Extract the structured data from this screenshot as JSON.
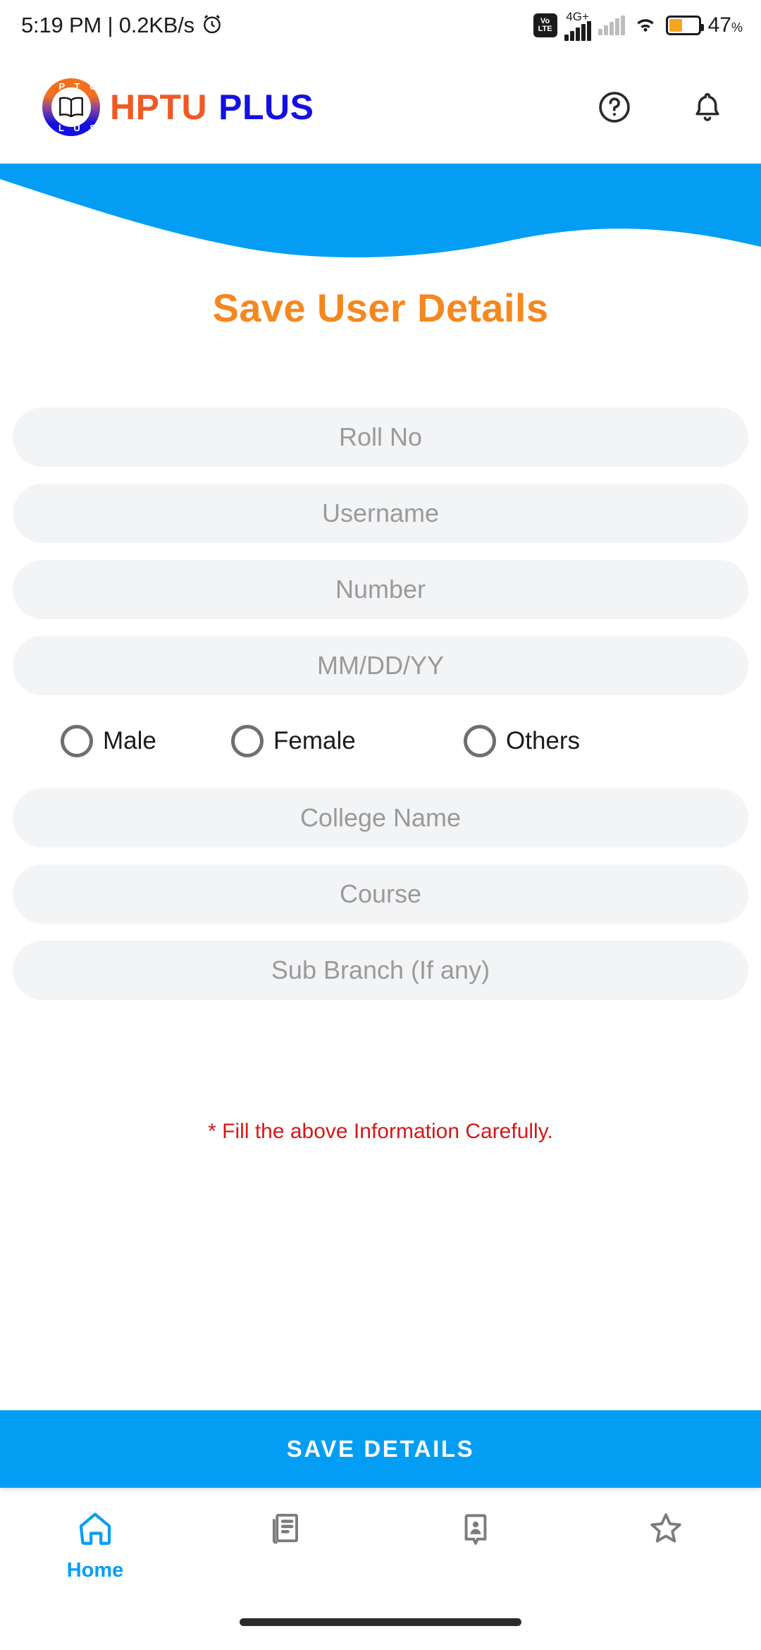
{
  "status_bar": {
    "time": "5:19 PM",
    "separator": "|",
    "data_rate": "0.2KB/s",
    "alarm_icon": "alarm-icon",
    "volte_top": "Vo",
    "volte_bottom": "LTE",
    "network_type": "4G+",
    "wifi_icon": "wifi-icon",
    "battery_percent": "47",
    "battery_unit": "%"
  },
  "header": {
    "logo_arc_top": "H P T U",
    "logo_arc_bottom": "P L U S",
    "brand_primary": "HPTU",
    "brand_secondary": "PLUS",
    "help_icon": "help-circle-icon",
    "bell_icon": "bell-icon"
  },
  "colors": {
    "accent_blue": "#039ef4",
    "brand_orange": "#ef5a24",
    "brand_blue": "#1510e0",
    "title_orange": "#f5871f",
    "warning_red": "#d61717",
    "field_bg": "#f3f4f6",
    "placeholder": "#9a9a9a"
  },
  "main": {
    "title": "Save User Details",
    "fields": [
      {
        "name": "roll-no",
        "placeholder": "Roll No",
        "value": ""
      },
      {
        "name": "username",
        "placeholder": "Username",
        "value": ""
      },
      {
        "name": "number",
        "placeholder": "Number",
        "value": ""
      },
      {
        "name": "dob",
        "placeholder": "MM/DD/YY",
        "value": ""
      }
    ],
    "gender": {
      "options": [
        {
          "label": "Male",
          "selected": false
        },
        {
          "label": "Female",
          "selected": false
        },
        {
          "label": "Others",
          "selected": false
        }
      ]
    },
    "fields2": [
      {
        "name": "college-name",
        "placeholder": "College Name",
        "value": ""
      },
      {
        "name": "course",
        "placeholder": "Course",
        "value": ""
      },
      {
        "name": "sub-branch",
        "placeholder": "Sub Branch (If any)",
        "value": ""
      }
    ],
    "note": "* Fill the above Information Carefully."
  },
  "save_button": {
    "label": "SAVE DETAILS"
  },
  "bottom_nav": {
    "items": [
      {
        "icon": "home-icon",
        "label": "Home",
        "active": true
      },
      {
        "icon": "news-article-icon",
        "label": "",
        "active": false
      },
      {
        "icon": "contact-card-icon",
        "label": "",
        "active": false
      },
      {
        "icon": "star-icon",
        "label": "",
        "active": false
      }
    ]
  }
}
